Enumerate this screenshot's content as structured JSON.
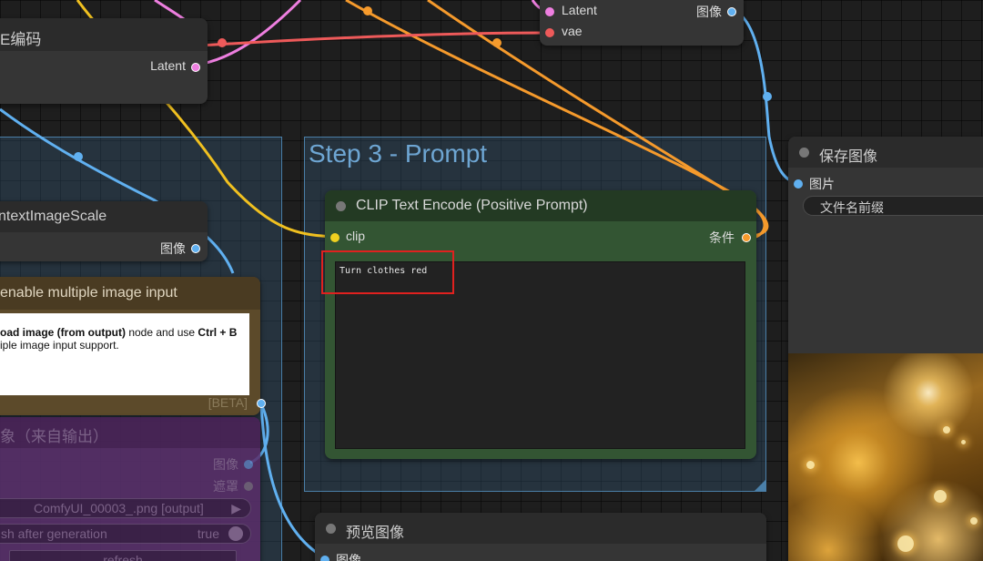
{
  "colors": {
    "canvas_bg": "#1e1e1e",
    "group_border": "#4a7fa8",
    "group_title": "#6ea6d3",
    "clip_node_bg": "#335533",
    "clip_title_bg": "#233a23",
    "note_title_bg": "#5c4a2a",
    "load_node_bg": "#5a2e6a",
    "wire_yellow": "#f0c020",
    "wire_orange": "#f59a2c",
    "wire_pink": "#ee7fe0",
    "wire_red": "#ee5a5a",
    "wire_blue": "#60b0f0",
    "highlight_box": "#e0211f"
  },
  "vae_encode_node": {
    "title": "E编码",
    "output_latent": "Latent"
  },
  "vae_decode_node": {
    "input_latent": "Latent",
    "input_vae": "vae",
    "output_image": "图像"
  },
  "group_step3": {
    "title": "Step 3 - Prompt"
  },
  "scale_node": {
    "title": "ntextImageScale",
    "output_image": "图像"
  },
  "note_node": {
    "title": "enable multiple image input",
    "line1_bold_a": "oad image (from output)",
    "line1_plain": " node and use ",
    "line1_bold_b": "Ctrl + B",
    "line2": "iple image input support.",
    "beta_badge": "[BETA]"
  },
  "load_image_node": {
    "title": "象（来自输出）",
    "output_image": "图像",
    "output_mask": "遮罩",
    "image_value": "ComfyUI_00003_.png [output]",
    "refresh_toggle_label": "sh after generation",
    "refresh_toggle_value": "true",
    "refresh_button": "refresh"
  },
  "clip_node": {
    "title": "CLIP Text Encode (Positive Prompt)",
    "input_clip": "clip",
    "output_conditioning": "条件",
    "prompt_text": "Turn clothes red"
  },
  "save_node": {
    "title": "保存图像",
    "input_images": "图片",
    "filename_prefix_label": "文件名前缀"
  },
  "preview_node": {
    "title": "预览图像",
    "input_images": "图像"
  },
  "icons": {
    "play": "play-triangle-icon",
    "toggle": "toggle-knob-icon",
    "title_dot": "node-collapse-dot-icon",
    "resize": "group-resize-corner-icon"
  }
}
